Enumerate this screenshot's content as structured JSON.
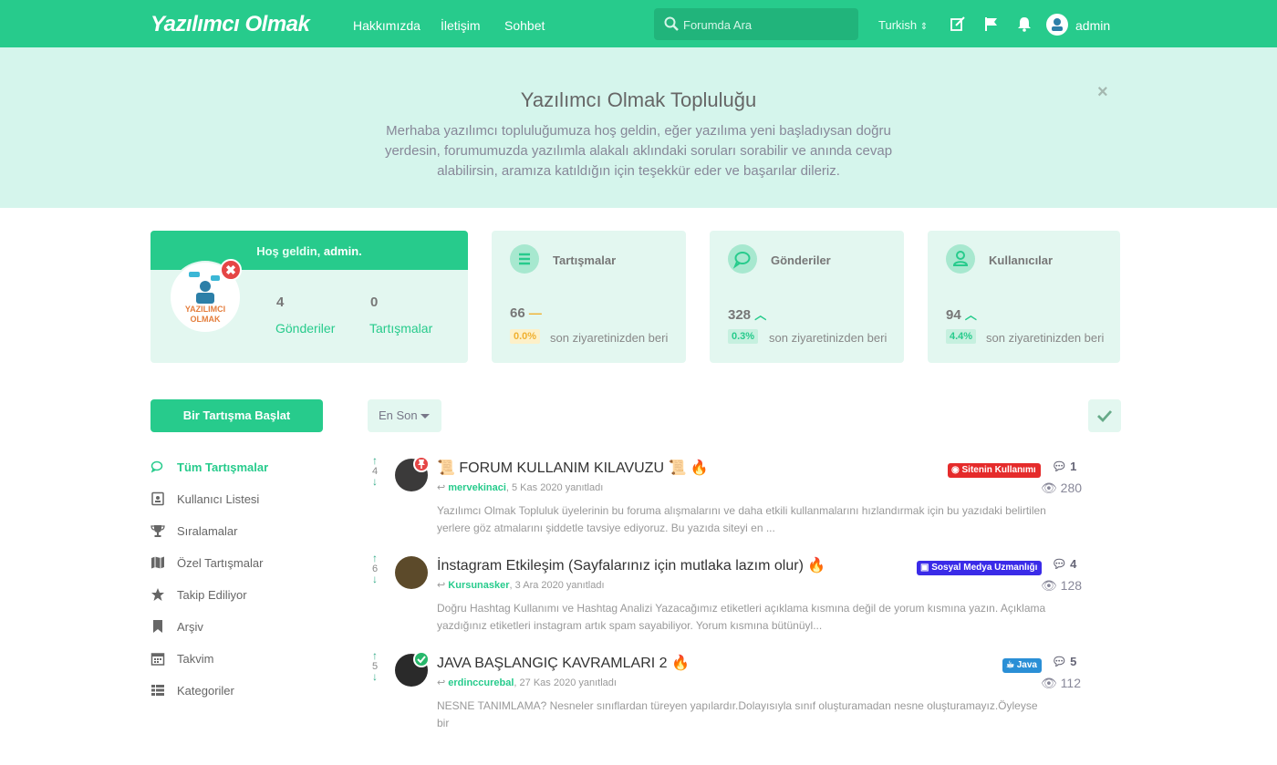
{
  "header": {
    "logo": "Yazılımcı Olmak",
    "nav": [
      "Hakkımızda",
      "İletişim",
      "Sohbet"
    ],
    "search_placeholder": "Forumda Ara",
    "language": "Turkish",
    "username": "admin"
  },
  "hero": {
    "title": "Yazılımcı Olmak Topluluğu",
    "text": "Merhaba yazılımcı topluluğumuza hoş geldin, eğer yazılıma yeni başladıysan doğru yerdesin, forumumuzda yazılımla alakalı aklındaki soruları sorabilir ve anında cevap alabilirsin, aramıza katıldığın için teşekkür eder ve başarılar dileriz.",
    "close": "×"
  },
  "welcome": {
    "greeting": "Hoş geldin,",
    "user": "admin.",
    "avatar_text": "YAZILIMCI OLMAK",
    "posts_count": "4",
    "posts_label": "Gönderiler",
    "discussions_count": "0",
    "discussions_label": "Tartışmalar"
  },
  "stats": [
    {
      "title": "Tartışmalar",
      "value": "66",
      "trend": "flat",
      "pct": "0.0%",
      "since": "son ziyaretinizden beri"
    },
    {
      "title": "Gönderiler",
      "value": "328",
      "trend": "up",
      "pct": "0.3%",
      "since": "son ziyaretinizden beri"
    },
    {
      "title": "Kullanıcılar",
      "value": "94",
      "trend": "up",
      "pct": "4.4%",
      "since": "son ziyaretinizden beri"
    }
  ],
  "sidebar": {
    "start_button": "Bir Tartışma Başlat",
    "items": [
      {
        "label": "Tüm Tartışmalar",
        "active": true
      },
      {
        "label": "Kullanıcı Listesi"
      },
      {
        "label": "Sıralamalar"
      },
      {
        "label": "Özel Tartışmalar"
      },
      {
        "label": "Takip Ediliyor"
      },
      {
        "label": "Arşiv"
      },
      {
        "label": "Takvim"
      },
      {
        "label": "Kategoriler"
      }
    ]
  },
  "toolbar": {
    "sort": "En Son"
  },
  "discussions": [
    {
      "votes": "4",
      "title": "📜 FORUM KULLANIM KILAVUZU 📜 🔥",
      "author": "mervekinaci",
      "date": ", 5 Kas 2020 yanıtladı",
      "excerpt": "Yazılımcı Olmak Topluluk üyelerinin bu foruma alışmalarını ve daha etkili kullanmalarını hızlandırmak için bu yazıdaki belirtilen yerlere göz atmalarını şiddetle tavsiye ediyoruz. Bu yazıda siteyi en ...",
      "tag": "Sitenin Kullanımı",
      "tag_color": "#e52b2b",
      "replies": "1",
      "views": "280"
    },
    {
      "votes": "6",
      "title": "İnstagram Etkileşim (Sayfalarınız için mutlaka lazım olur) 🔥",
      "author": "Kursunasker",
      "date": ", 3 Ara 2020 yanıtladı",
      "excerpt": "Doğru Hashtag Kullanımı ve Hashtag Analizi Yazacağımız etiketleri açıklama kısmına değil de yorum kısmına yazın. Açıklama yazdığınız etiketleri instagram artık spam sayabiliyor. Yorum kısmına bütünüyl...",
      "tag": "Sosyal Medya Uzmanlığı",
      "tag_color": "#3a2be8",
      "replies": "4",
      "views": "128"
    },
    {
      "votes": "5",
      "title": "JAVA BAŞLANGIÇ KAVRAMLARI 2 🔥",
      "author": "erdinccurebal",
      "date": ", 27 Kas 2020 yanıtladı",
      "excerpt": "NESNE TANIMLAMA? Nesneler sınıflardan türeyen yapılardır.Dolayısıyla sınıf oluşturamadan nesne oluşturamayız.Öyleyse bir",
      "tag": "Java",
      "tag_color": "#2a8fd6",
      "replies": "5",
      "views": "112"
    }
  ]
}
